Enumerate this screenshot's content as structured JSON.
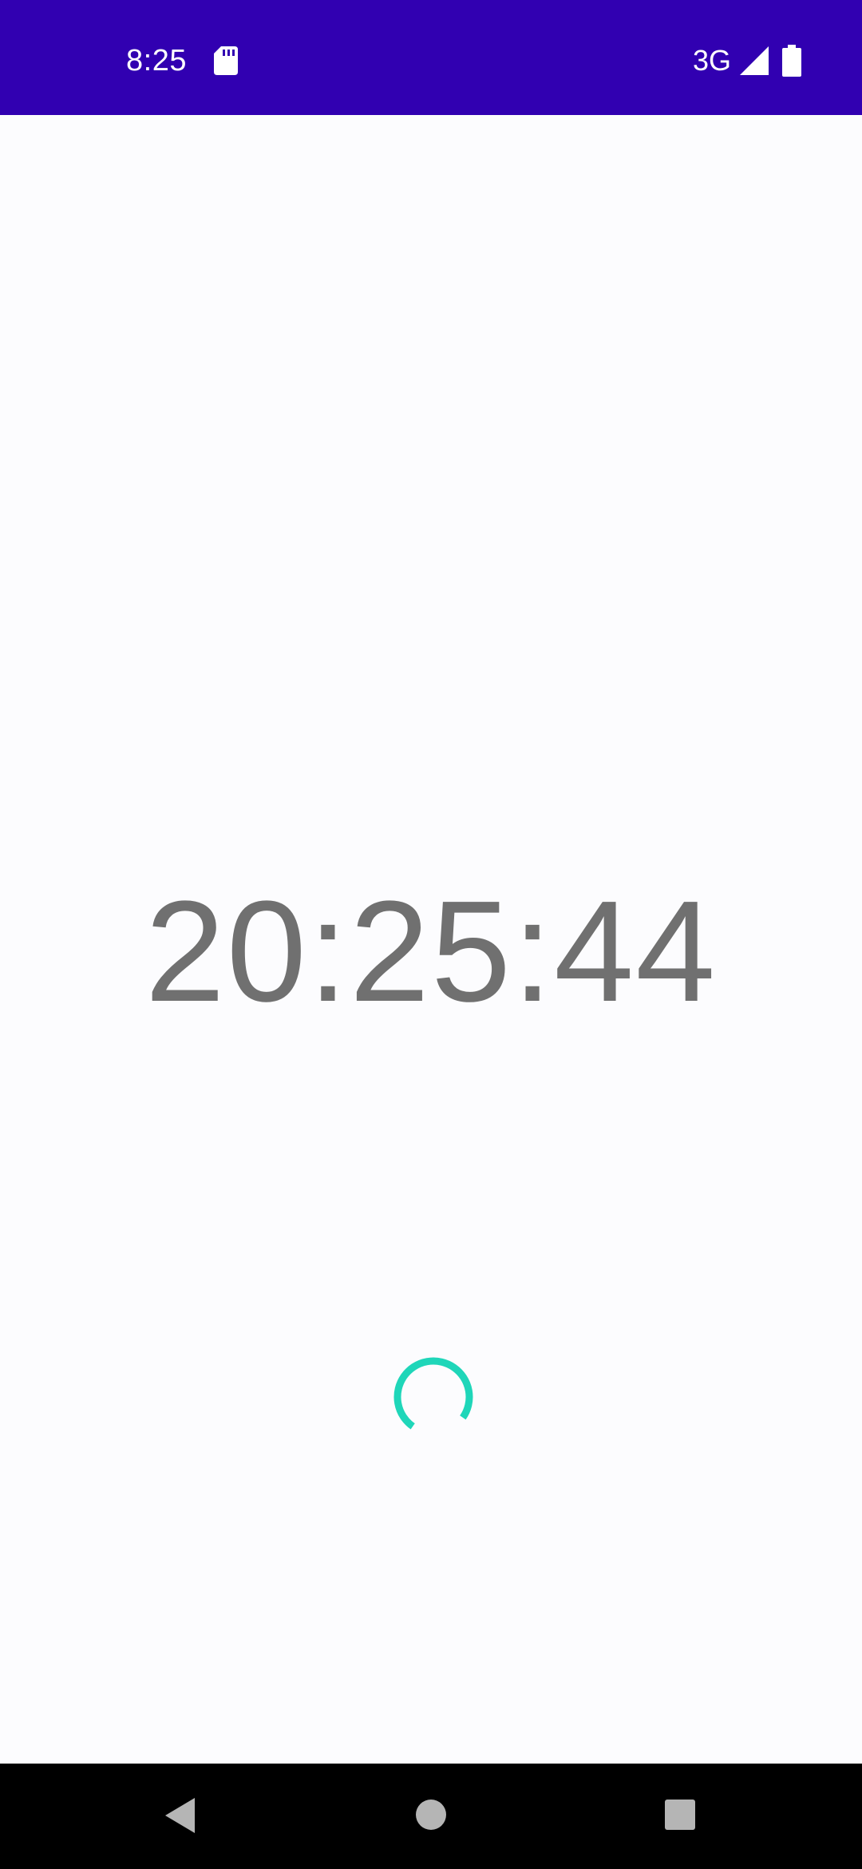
{
  "status_bar": {
    "time": "8:25",
    "network": "3G",
    "background_color": "#3100b1",
    "icons": [
      "sd-card-icon",
      "signal-icon",
      "battery-icon"
    ]
  },
  "main": {
    "clock_text": "20:25:44",
    "clock_color": "#707070",
    "spinner_color": "#1fd6b9"
  },
  "nav_bar": {
    "icons": [
      "back-icon",
      "home-icon",
      "recents-icon"
    ],
    "icon_color": "#b5b5b5"
  }
}
